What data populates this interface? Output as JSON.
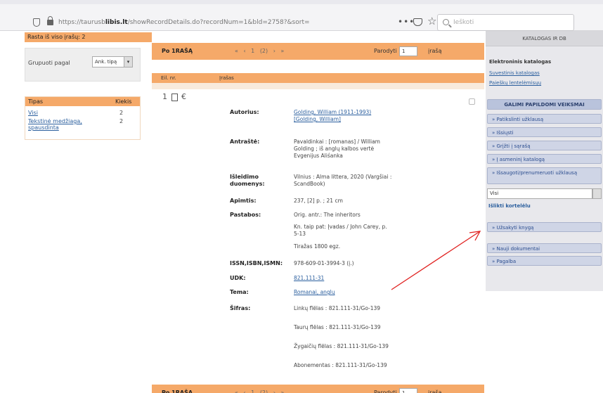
{
  "browser": {
    "url_prefix": "https://taurusb",
    "url_domain": "libis.lt",
    "url_path": "/showRecordDetails.do?recordNum=1&bld=2758?&sort=",
    "search_placeholder": "Ieškoti",
    "more_label": "•••"
  },
  "left": {
    "found_label": "Rasta iš viso įrašų: 2",
    "group_label": "Grupuoti pagal",
    "group_value": "Ank. tipą",
    "facet": {
      "col_type": "Tipas",
      "col_count": "Kiekis",
      "rows": [
        {
          "label": "Visi",
          "count": "2"
        },
        {
          "label": "Tekstinė medžiaga, spausdinta",
          "count": "2"
        }
      ]
    }
  },
  "pager": {
    "po_label": "Po 1RAŠĄ",
    "nav": "« ‹ 1 (2) › »",
    "show_label": "Parodyti",
    "show_value": "1",
    "records_label": "įrašą"
  },
  "record": {
    "col_no": "Eil. nr.",
    "col_record": "Įrašas",
    "icon_text": "1",
    "fields": [
      {
        "label": "Autorius:",
        "value": "Golding, William (1911-1993) [Golding, William]",
        "link": true
      },
      {
        "label": "Antraštė:",
        "value": "Pavaldinkai : [romanas] / William Golding ; iš anglų kalbos vertė Evgenijus Aliśanka",
        "link": false
      },
      {
        "label": "Išleidimo duomenys:",
        "value": "Vilnius : Alma littera, 2020 (Vargšiai : ScandBook)",
        "link": false
      },
      {
        "label": "Apimtis:",
        "value": "237, [2] p. ; 21 cm",
        "link": false
      },
      {
        "label": "Pastabos:",
        "value": "Orig. antr.: The inheritors",
        "link": false
      },
      {
        "label": "",
        "value": "Kn. taip pat: Įvadas / John Carey, p. 5-13",
        "link": false
      },
      {
        "label": "",
        "value": "Tiražas 1800 egz.",
        "link": false
      },
      {
        "label": "ISSN,ISBN,ISMN:",
        "value": "978-609-01-3994-3 (į.)",
        "link": false
      },
      {
        "label": "UDK:",
        "value": "821.111-31",
        "link": true
      },
      {
        "label": "Tema:",
        "value": "Romanai, anglų",
        "link": true
      },
      {
        "label": "Šifras:",
        "value": "Linkų flëlas : 821.111-31/Go-139",
        "link": false
      },
      {
        "label": "",
        "value": "Taurų flëlas : 821.111-31/Go-139",
        "link": false
      },
      {
        "label": "",
        "value": "Žygaičių flëlas : 821.111-31/Go-139",
        "link": false
      },
      {
        "label": "",
        "value": "Abonementas : 821.111-31/Go-139",
        "link": false
      }
    ]
  },
  "right": {
    "header": "KATALOGAS IR DB",
    "catalog_title": "Elektroninis katalogas",
    "link1": "Suvestinis katalogas",
    "link2": "Paieškų lentelėmisųų",
    "section_header": "GALIMI PAPILDOMI VEIKSMAI",
    "buttons": [
      "» Patikslinti užklausą",
      "» Išsiųsti",
      "» Grįžti į sąrašą",
      "» Į asmeninį katalogą",
      "» Išsaugoti/prenumeruoti užklausą"
    ],
    "input_value": "Visi",
    "link3": "Išlikti kortelėlu",
    "btn_order": "» Užsakyti knygą",
    "btn_new": "» Nauji dokumentai",
    "btn_help": "» Pagalba"
  },
  "annotation": {
    "color": "#e0211f"
  }
}
